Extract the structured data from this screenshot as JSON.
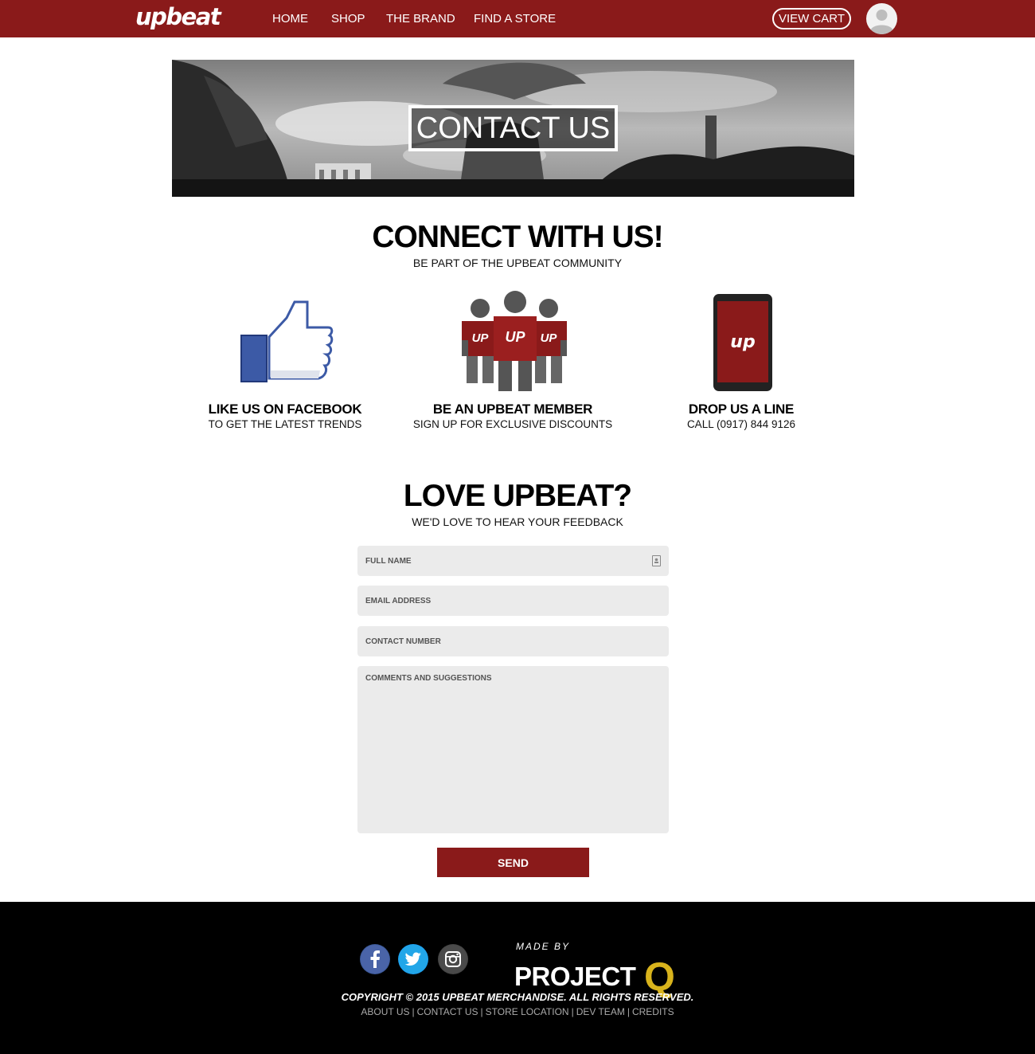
{
  "brand": {
    "logo_text": "upbeat",
    "accent_color": "#8a1a1a"
  },
  "nav": {
    "links": [
      "HOME",
      "SHOP",
      "THE BRAND",
      "FIND A STORE"
    ],
    "cart_label": "VIEW CART",
    "avatar_icon": "user-avatar-icon"
  },
  "hero": {
    "title": "CONTACT US"
  },
  "connect": {
    "title": "CONNECT WITH US!",
    "subtitle": "BE PART OF THE UPBEAT COMMUNITY",
    "items": [
      {
        "icon": "thumbs-up-icon",
        "title": "LIKE US ON FACEBOOK",
        "subtitle": "TO GET THE LATEST TRENDS"
      },
      {
        "icon": "members-group-icon",
        "title": "BE AN UPBEAT MEMBER",
        "subtitle": "SIGN UP FOR EXCLUSIVE DISCOUNTS",
        "badge_text": "UP"
      },
      {
        "icon": "phone-icon",
        "title": "DROP US A LINE",
        "subtitle": "CALL (0917) 844 9126",
        "screen_text": "up"
      }
    ]
  },
  "feedback": {
    "title": "LOVE UPBEAT?",
    "subtitle": "WE'D LOVE TO HEAR YOUR FEEDBACK",
    "fields": {
      "full_name": "FULL NAME",
      "email": "EMAIL ADDRESS",
      "contact_number": "CONTACT NUMBER",
      "comments": "COMMENTS AND SUGGESTIONS"
    },
    "send_label": "SEND"
  },
  "footer": {
    "social_icons": [
      "facebook-icon",
      "twitter-icon",
      "instagram-icon"
    ],
    "made_by": "MADE BY",
    "project_name": "PROJECT",
    "project_letter": "Q",
    "project_letter_color": "#d8b31c",
    "copyright": "COPYRIGHT © 2015 UPBEAT MERCHANDISE.  ALL RIGHTS RESERVED.",
    "links": [
      "ABOUT US",
      "CONTACT US",
      "STORE LOCATION",
      "DEV TEAM",
      "CREDITS"
    ]
  }
}
